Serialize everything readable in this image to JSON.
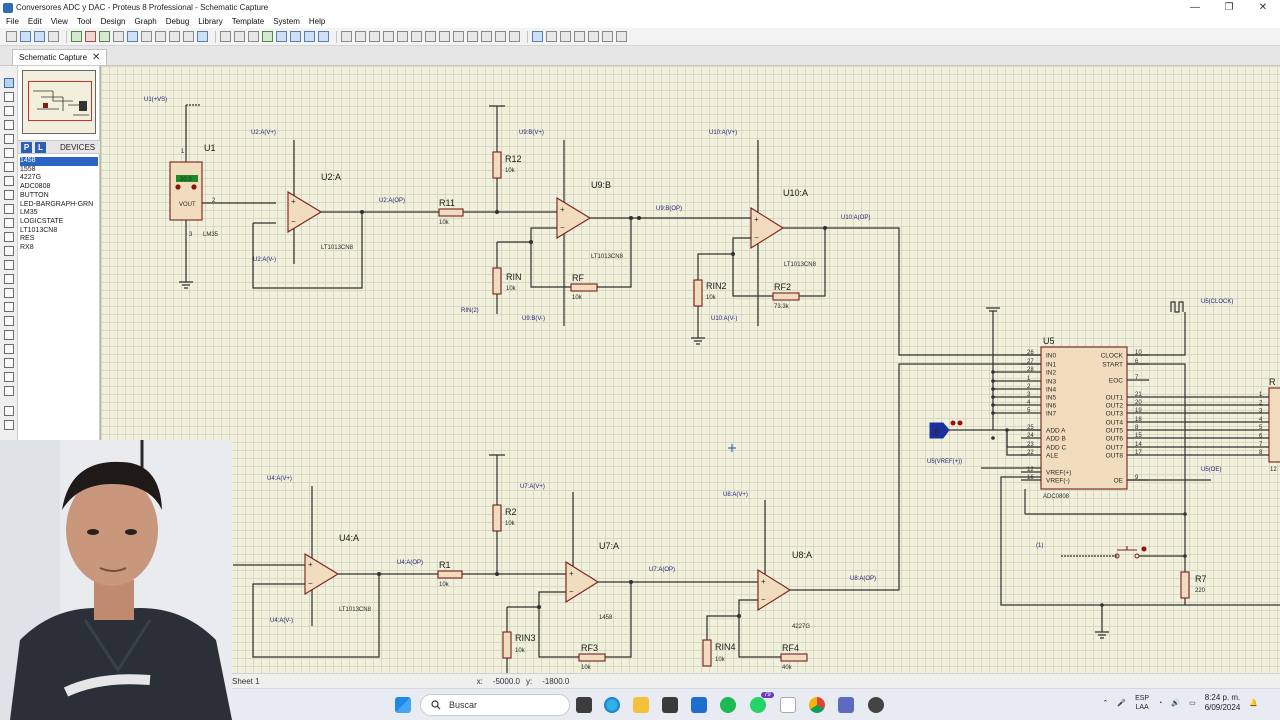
{
  "window": {
    "title": "Conversores ADC y DAC - Proteus 8 Professional - Schematic Capture",
    "minimize": "—",
    "maximize": "❐",
    "close": "✕"
  },
  "menu": [
    "File",
    "Edit",
    "View",
    "Tool",
    "Design",
    "Graph",
    "Debug",
    "Library",
    "Template",
    "System",
    "Help"
  ],
  "tab": {
    "label": "Schematic Capture",
    "close": "✕"
  },
  "devices": {
    "header": "DEVICES",
    "p_label": "P",
    "l_label": "L",
    "items": [
      "1458",
      "1558",
      "4227G",
      "ADC0808",
      "BUTTON",
      "LED-BARGRAPH-GRN",
      "LM35",
      "LOGICSTATE",
      "LT1013CN8",
      "RES",
      "RX8"
    ],
    "selected": "1458"
  },
  "schematic": {
    "u1": {
      "ref": "U1",
      "display": "20.0",
      "vout": "VOUT",
      "part": "LM35",
      "pin_vs": "1",
      "pin_out": "2",
      "pin_gnd": "3"
    },
    "top_labels": {
      "u1_vs": "U1(+VS)",
      "u2_vp": "U2:A(V+)",
      "u2_ref": "U2:A",
      "u2_op": "U2:A(OP)",
      "u2_vm": "U2:A(V-)",
      "u2_part": "LT1013CN8",
      "r11": "R11",
      "r11_val": "10k",
      "r12": "R12",
      "r12_val": "10k",
      "u9_vp": "U9:B(V+)",
      "u9_ref": "U9:B",
      "u9_op": "U9:B(OP)",
      "u9_part": "LT1013CN8",
      "rin": "RIN",
      "rin_val": "10k",
      "rf": "RF",
      "rf_val": "10k",
      "rin2_net": "RIN(2)",
      "u9_vm": "U9:B(V-)",
      "u10_vp": "U10:A(V+)",
      "u10_ref": "U10:A",
      "u10_op": "U10:A(OP)",
      "u10_part": "LT1013CN8",
      "rin2": "RIN2",
      "rin2_val": "10k",
      "rf2": "RF2",
      "rf2_val": "73.3k",
      "u10_vm": "U10:A(V-)"
    },
    "bottom_labels": {
      "u4_vp": "U4:A(V+)",
      "u4_ref": "U4:A",
      "u4_op": "U4:A(OP)",
      "u4_part": "LT1013CN8",
      "u4_vm": "U4:A(V-)",
      "r1": "R1",
      "r1_val": "10k",
      "r2": "R2",
      "r2_val": "10k",
      "u7_vp": "U7:A(V+)",
      "u7_ref": "U7:A",
      "u7_op": "U7:A(OP)",
      "u7_part": "1458",
      "rin3": "RIN3",
      "rin3_val": "10k",
      "rf3": "RF3",
      "rf3_val": "10k",
      "u8_vp": "U8:A(V+)",
      "u8_ref": "U8:A",
      "u8_op": "U8:A(OP)",
      "u8_part": "4227G",
      "rin4": "RIN4",
      "rin4_val": "10k",
      "rf4": "RF4",
      "rf4_val": "40k"
    },
    "adc": {
      "ref": "U5",
      "part": "ADC0808",
      "left_pins": [
        "IN0",
        "IN1",
        "IN2",
        "IN3",
        "IN4",
        "IN5",
        "IN6",
        "IN7",
        "ADD A",
        "ADD B",
        "ADD C",
        "ALE",
        "VREF(+)",
        "VREF(-)"
      ],
      "left_nums": [
        "26",
        "27",
        "28",
        "1",
        "2",
        "3",
        "4",
        "5",
        "25",
        "24",
        "23",
        "22",
        "12",
        "16"
      ],
      "right_pins": [
        "CLOCK",
        "START",
        "EOC",
        "OUT1",
        "OUT2",
        "OUT3",
        "OUT4",
        "OUT5",
        "OUT6",
        "OUT7",
        "OUT8",
        "OE"
      ],
      "right_nums": [
        "10",
        "6",
        "7",
        "21",
        "20",
        "19",
        "18",
        "8",
        "15",
        "14",
        "17",
        "9"
      ],
      "clock_net": "U5(CLOCK)",
      "vref_net": "U5(VREF(+))",
      "oe_net": "U5(OE)",
      "logic_state": "0",
      "r7": "R7",
      "r7_val": "220",
      "net_one": "(1)",
      "rx_partial": "R",
      "rx_pins": [
        "1",
        "2",
        "3",
        "4",
        "5",
        "6",
        "7",
        "8"
      ],
      "rx_side": "12"
    }
  },
  "status": {
    "sheet": "Sheet 1",
    "x_label": "x:",
    "x_value": "-5000.0",
    "y_label": "y:",
    "y_value": "-1800.0"
  },
  "taskbar": {
    "search_placeholder": "Buscar",
    "whatsapp_badge": "79",
    "language": "ESP",
    "layout": "LAA",
    "time": "8:24 p. m.",
    "date": "6/09/2024"
  }
}
